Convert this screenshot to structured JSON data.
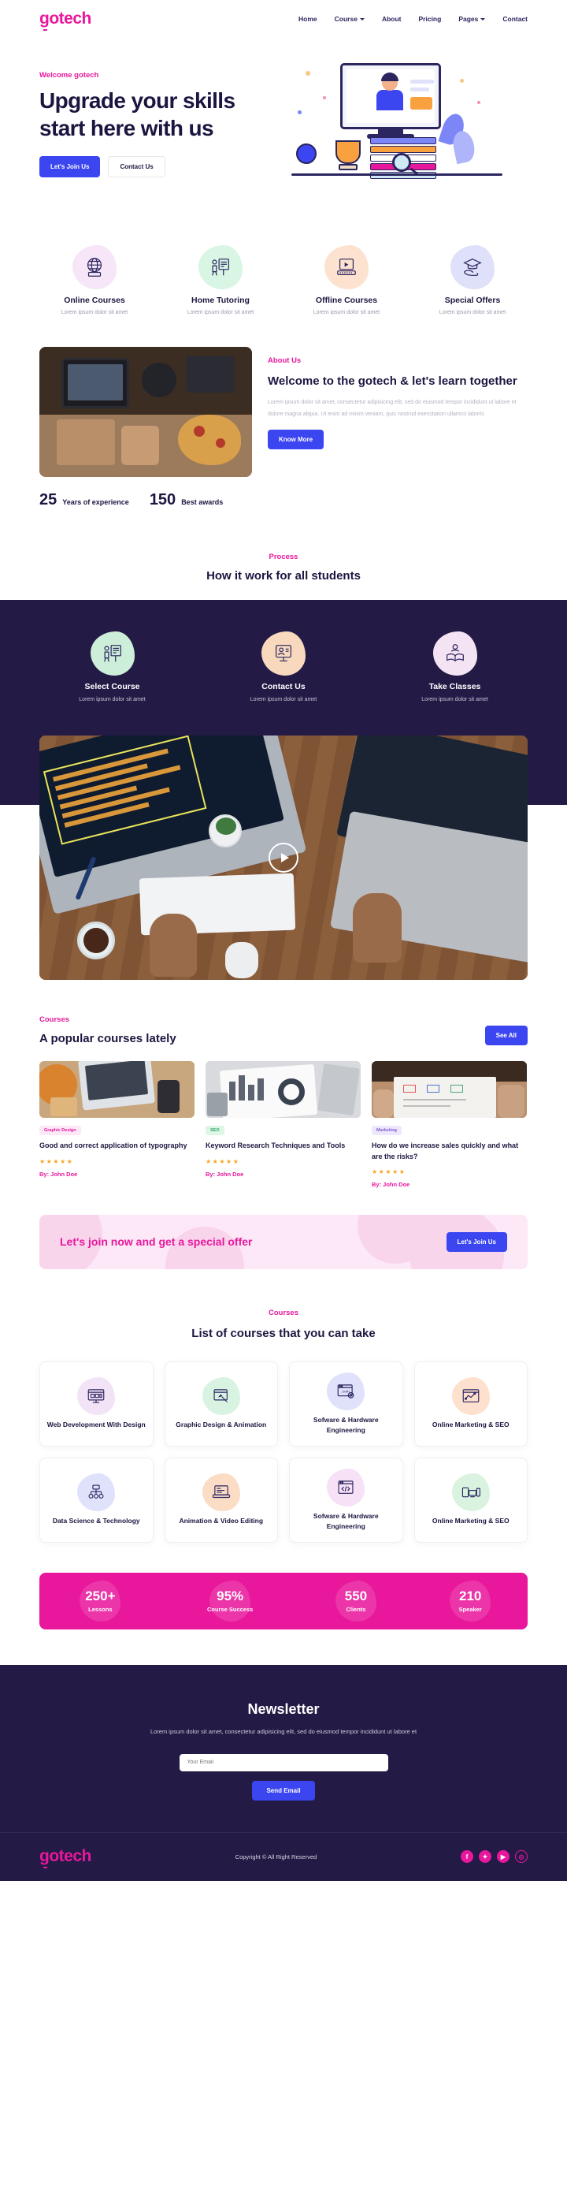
{
  "brand": {
    "name": "gotech",
    "pink": "#e8179c",
    "indigo": "#3b46f1",
    "dark": "#241a46"
  },
  "header": {
    "logo": "gotech",
    "nav": [
      {
        "label": "Home",
        "caret": false
      },
      {
        "label": "Course",
        "caret": true
      },
      {
        "label": "About",
        "caret": false
      },
      {
        "label": "Pricing",
        "caret": false
      },
      {
        "label": "Pages",
        "caret": true
      },
      {
        "label": "Contact",
        "caret": false
      }
    ]
  },
  "hero": {
    "eyebrow": "Welcome gotech",
    "title": "Upgrade your skills start here with us",
    "primary_btn": "Let's Join Us",
    "secondary_btn": "Contact Us"
  },
  "features": [
    {
      "title": "Online Courses",
      "desc": "Lorem ipsum dolor sit amet",
      "icon": "globe-book-icon",
      "blob": "#f6e6f8"
    },
    {
      "title": "Home Tutoring",
      "desc": "Lorem ipsum dolor sit amet",
      "icon": "whiteboard-teacher-icon",
      "blob": "#d9f5e4"
    },
    {
      "title": "Offline Courses",
      "desc": "Lorem ipsum dolor sit amet",
      "icon": "laptop-icon",
      "blob": "#fde2cf"
    },
    {
      "title": "Special Offers",
      "desc": "Lorem ipsum dolor sit amet",
      "icon": "graduation-hand-icon",
      "blob": "#dfe1fa"
    }
  ],
  "about": {
    "eyebrow": "About Us",
    "title": "Welcome to the gotech & let's learn together",
    "paragraph": "Lorem ipsum dolor sit amet, consectetur adipisicing elit, sed do eiusmod tempor incididunt ut labore et dolore magna aliqua. Ut enim ad minim veniam, quis nostrud exercitation ullamco laboris",
    "button": "Know More",
    "stats": [
      {
        "num": "25",
        "label": "Years of experience"
      },
      {
        "num": "150",
        "label": "Best awards"
      }
    ]
  },
  "process": {
    "eyebrow": "Process",
    "title": "How it work for all students",
    "steps": [
      {
        "title": "Select Course",
        "desc": "Lorem ipsum dolor sit amet",
        "icon": "whiteboard-teacher-icon",
        "blob": "#cdeed8"
      },
      {
        "title": "Contact Us",
        "desc": "Lorem ipsum dolor sit amet",
        "icon": "video-call-icon",
        "blob": "#f8d9bd"
      },
      {
        "title": "Take Classes",
        "desc": "Lorem ipsum dolor sit amet",
        "icon": "reading-book-icon",
        "blob": "#f4e3f2"
      }
    ]
  },
  "video": {
    "play_label": "play-video"
  },
  "courses": {
    "eyebrow": "Courses",
    "title": "A popular courses lately",
    "see_all": "See All",
    "cards": [
      {
        "tag": "Graphic Design",
        "tag_bg": "#fce8f6",
        "tag_color": "#e8179c",
        "title": "Good and correct application of typography",
        "stars": "★★★★★",
        "by": "By: John Doe"
      },
      {
        "tag": "SEO",
        "tag_bg": "#ddf6e6",
        "tag_color": "#2fa86a",
        "title": "Keyword Research Techniques and Tools",
        "stars": "★★★★★",
        "by": "By: John Doe"
      },
      {
        "tag": "Marketing",
        "tag_bg": "#eee7fb",
        "tag_color": "#7b5cd6",
        "title": "How do we increase sales quickly and what are the risks?",
        "stars": "★★★★★",
        "by": "By: John Doe"
      }
    ]
  },
  "cta": {
    "title": "Let's join now and get a special offer",
    "button": "Let's Join Us"
  },
  "categories": {
    "eyebrow": "Courses",
    "title": "List of courses that you can take",
    "items": [
      {
        "title": "Web Development With Design",
        "icon": "desktop-code-icon",
        "blob": "#f3e3f7"
      },
      {
        "title": "Graphic Design & Animation",
        "icon": "pen-window-icon",
        "blob": "#d9f3e3"
      },
      {
        "title": "Sofware & Hardware Engineering",
        "icon": "browser-gear-icon",
        "blob": "#dfe2fa"
      },
      {
        "title": "Online Marketing & SEO",
        "icon": "chart-window-icon",
        "blob": "#fde0cd"
      },
      {
        "title": "Data Science & Technology",
        "icon": "sitemap-icon",
        "blob": "#dfe2fa"
      },
      {
        "title": "Animation & Video Editing",
        "icon": "laptop-timeline-icon",
        "blob": "#fbdcc4"
      },
      {
        "title": "Sofware & Hardware Engineering",
        "icon": "code-window-icon",
        "blob": "#f6e1f6"
      },
      {
        "title": "Online Marketing & SEO",
        "icon": "responsive-devices-icon",
        "blob": "#d9f3e0"
      }
    ]
  },
  "pink_stats": [
    {
      "num": "250+",
      "label": "Lessons"
    },
    {
      "num": "95%",
      "label": "Course Success"
    },
    {
      "num": "550",
      "label": "Clients"
    },
    {
      "num": "210",
      "label": "Speaker"
    }
  ],
  "newsletter": {
    "title": "Newsletter",
    "desc": "Lorem ipsum dolor sit amet, consectetur adipisicing elit, sed do eiusmod tempor incididunt ut labore et",
    "placeholder": "Your Email",
    "button": "Send Email"
  },
  "footer": {
    "logo": "gotech",
    "copyright": "Copyright © All Right Reserved",
    "socials": [
      {
        "name": "facebook-icon",
        "glyph": "f",
        "outline": false
      },
      {
        "name": "twitter-icon",
        "glyph": "✦",
        "outline": false
      },
      {
        "name": "youtube-icon",
        "glyph": "▶",
        "outline": false
      },
      {
        "name": "instagram-icon",
        "glyph": "◎",
        "outline": true
      }
    ]
  }
}
